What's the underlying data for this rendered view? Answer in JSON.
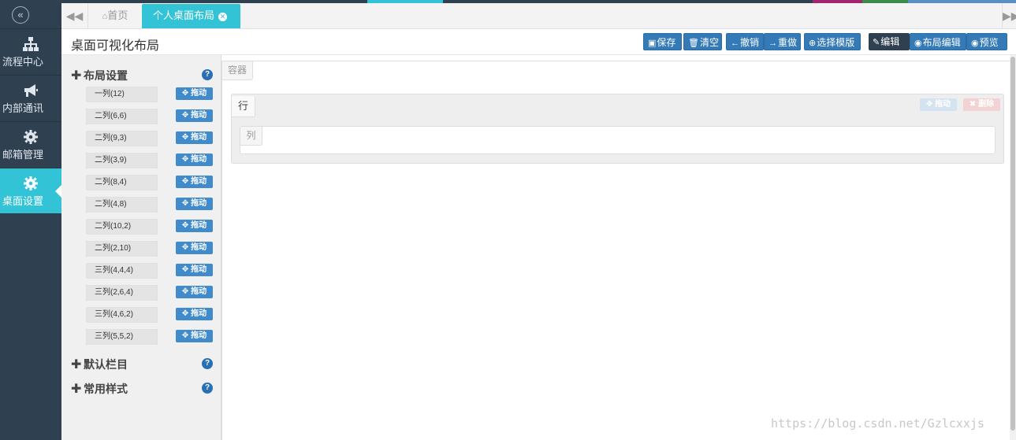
{
  "colors": {
    "sidebar_bg": "#2f4050",
    "accent": "#33c3d6",
    "primary": "#337ab7",
    "dark_button": "#2f4050"
  },
  "sidebar": {
    "collapse_icon": "double-chevron-left-icon",
    "items": [
      {
        "label": "流程中心",
        "icon": "sitemap-icon",
        "active": false
      },
      {
        "label": "内部通讯",
        "icon": "bullhorn-icon",
        "active": false
      },
      {
        "label": "邮箱管理",
        "icon": "gear-icon",
        "active": false
      },
      {
        "label": "桌面设置",
        "icon": "gear-icon",
        "active": true
      }
    ]
  },
  "tabs": {
    "home_label": "首页",
    "active_label": "个人桌面布局"
  },
  "header": {
    "title": "桌面可视化布局",
    "buttons": {
      "save": "保存",
      "clear": "清空",
      "undo": "撤销",
      "redo": "重做",
      "template": "选择模版",
      "edit": "编辑",
      "layout_edit": "布局编辑",
      "preview": "预览"
    }
  },
  "left_panel": {
    "sections": {
      "layout": "布局设置",
      "default_columns": "默认栏目",
      "common_styles": "常用样式"
    },
    "drag_label": "拖动",
    "layout_items": [
      "一列(12)",
      "二列(6,6)",
      "二列(9,3)",
      "二列(3,9)",
      "二列(8,4)",
      "二列(4,8)",
      "二列(10,2)",
      "二列(2,10)",
      "三列(4,4,4)",
      "三列(2,6,4)",
      "三列(4,6,2)",
      "三列(5,5,2)"
    ]
  },
  "canvas": {
    "container_label": "容器",
    "row_label": "行",
    "row_drag": "拖动",
    "row_delete": "删除",
    "col_label": "列"
  },
  "watermark": "https://blog.csdn.net/Gzlcxxjs"
}
